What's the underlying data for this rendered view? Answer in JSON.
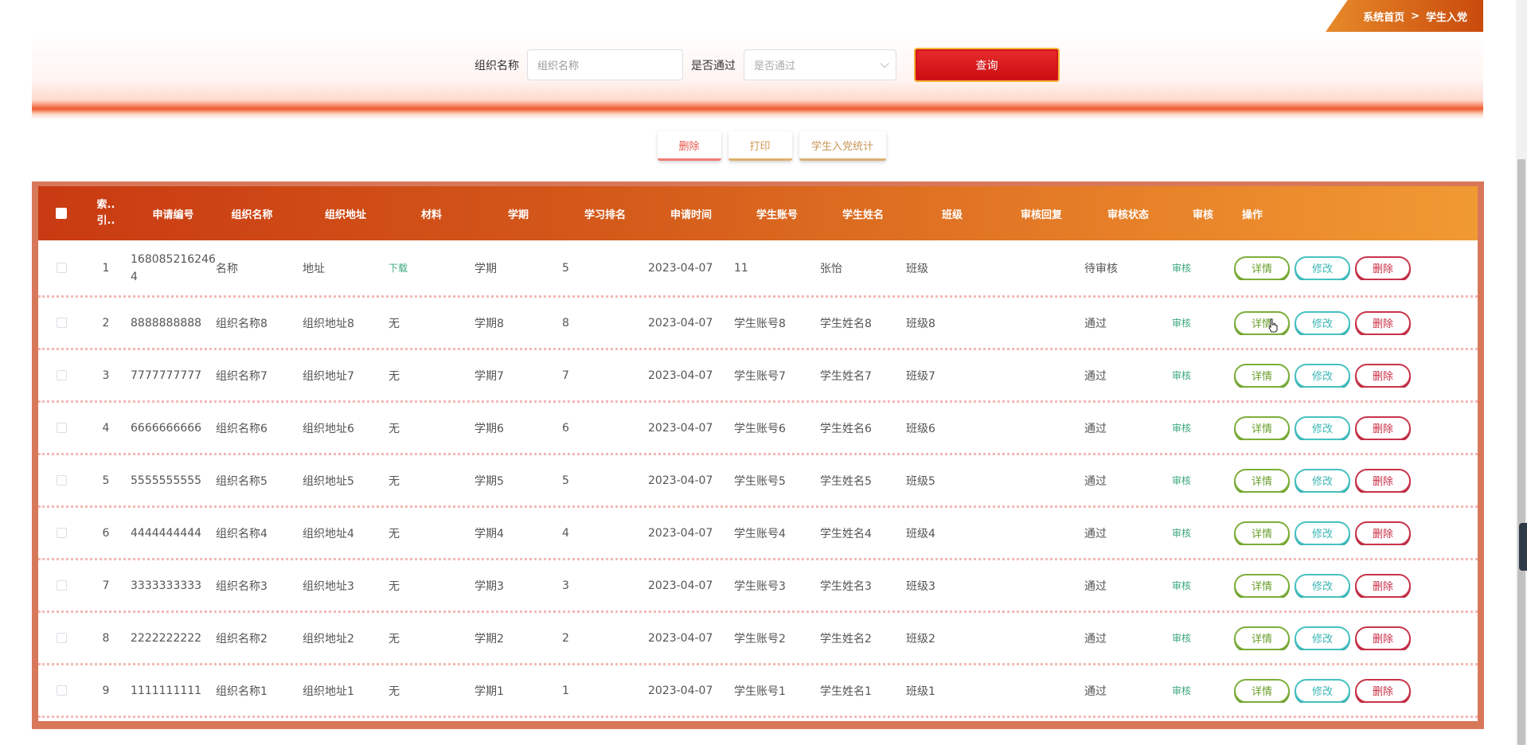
{
  "breadcrumb": {
    "home": "系统首页",
    "sep": ">",
    "current": "学生入党"
  },
  "search": {
    "org_label": "组织名称",
    "org_placeholder": "组织名称",
    "pass_label": "是否通过",
    "pass_placeholder": "是否通过",
    "query_label": "查询"
  },
  "actions": {
    "delete": "删除",
    "print": "打印",
    "stats": "学生入党统计"
  },
  "table": {
    "headers": {
      "index": "索.. 引..",
      "apply_no": "申请编号",
      "org_name": "组织名称",
      "org_addr": "组织地址",
      "material": "材料",
      "term": "学期",
      "rank": "学习排名",
      "apply_time": "申请时间",
      "account": "学生账号",
      "student_name": "学生姓名",
      "class": "班级",
      "reply": "审核回复",
      "status": "审核状态",
      "audit": "审核",
      "operation": "操作"
    },
    "ops": {
      "detail": "详情",
      "edit": "修改",
      "delete": "删除"
    },
    "rows": [
      {
        "index": "1",
        "apply_no": "1680852162464",
        "org_name": "名称",
        "org_addr": "地址",
        "material": "下载",
        "term": "学期",
        "rank": "5",
        "apply_time": "2023-04-07",
        "account": "11",
        "student_name": "张怡",
        "class": "班级",
        "reply": "",
        "status": "待审核",
        "audit": "审核"
      },
      {
        "index": "2",
        "apply_no": "8888888888",
        "org_name": "组织名称8",
        "org_addr": "组织地址8",
        "material": "无",
        "term": "学期8",
        "rank": "8",
        "apply_time": "2023-04-07",
        "account": "学生账号8",
        "student_name": "学生姓名8",
        "class": "班级8",
        "reply": "",
        "status": "通过",
        "audit": "审核"
      },
      {
        "index": "3",
        "apply_no": "7777777777",
        "org_name": "组织名称7",
        "org_addr": "组织地址7",
        "material": "无",
        "term": "学期7",
        "rank": "7",
        "apply_time": "2023-04-07",
        "account": "学生账号7",
        "student_name": "学生姓名7",
        "class": "班级7",
        "reply": "",
        "status": "通过",
        "audit": "审核"
      },
      {
        "index": "4",
        "apply_no": "6666666666",
        "org_name": "组织名称6",
        "org_addr": "组织地址6",
        "material": "无",
        "term": "学期6",
        "rank": "6",
        "apply_time": "2023-04-07",
        "account": "学生账号6",
        "student_name": "学生姓名6",
        "class": "班级6",
        "reply": "",
        "status": "通过",
        "audit": "审核"
      },
      {
        "index": "5",
        "apply_no": "5555555555",
        "org_name": "组织名称5",
        "org_addr": "组织地址5",
        "material": "无",
        "term": "学期5",
        "rank": "5",
        "apply_time": "2023-04-07",
        "account": "学生账号5",
        "student_name": "学生姓名5",
        "class": "班级5",
        "reply": "",
        "status": "通过",
        "audit": "审核"
      },
      {
        "index": "6",
        "apply_no": "4444444444",
        "org_name": "组织名称4",
        "org_addr": "组织地址4",
        "material": "无",
        "term": "学期4",
        "rank": "4",
        "apply_time": "2023-04-07",
        "account": "学生账号4",
        "student_name": "学生姓名4",
        "class": "班级4",
        "reply": "",
        "status": "通过",
        "audit": "审核"
      },
      {
        "index": "7",
        "apply_no": "3333333333",
        "org_name": "组织名称3",
        "org_addr": "组织地址3",
        "material": "无",
        "term": "学期3",
        "rank": "3",
        "apply_time": "2023-04-07",
        "account": "学生账号3",
        "student_name": "学生姓名3",
        "class": "班级3",
        "reply": "",
        "status": "通过",
        "audit": "审核"
      },
      {
        "index": "8",
        "apply_no": "2222222222",
        "org_name": "组织名称2",
        "org_addr": "组织地址2",
        "material": "无",
        "term": "学期2",
        "rank": "2",
        "apply_time": "2023-04-07",
        "account": "学生账号2",
        "student_name": "学生姓名2",
        "class": "班级2",
        "reply": "",
        "status": "通过",
        "audit": "审核"
      },
      {
        "index": "9",
        "apply_no": "1111111111",
        "org_name": "组织名称1",
        "org_addr": "组织地址1",
        "material": "无",
        "term": "学期1",
        "rank": "1",
        "apply_time": "2023-04-07",
        "account": "学生账号1",
        "student_name": "学生姓名1",
        "class": "班级1",
        "reply": "",
        "status": "通过",
        "audit": "审核"
      }
    ]
  }
}
